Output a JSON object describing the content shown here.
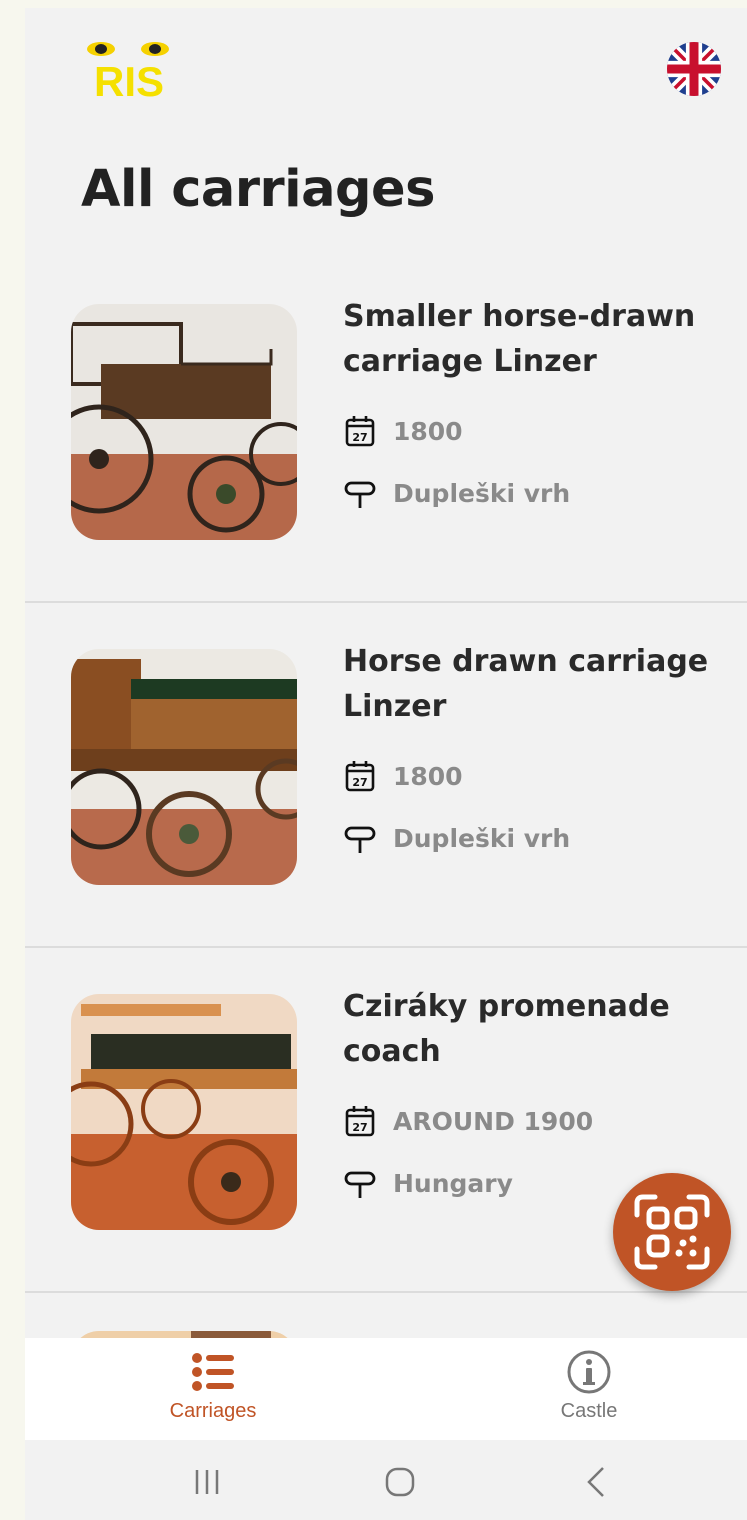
{
  "app": {
    "logo_text": "RIS",
    "language": "English (UK)",
    "title": "All carriages"
  },
  "carriages": [
    {
      "title": "Smaller horse-drawn carriage Linzer",
      "date": "1800",
      "location": "Dupleški vrh"
    },
    {
      "title": "Horse drawn carriage Linzer",
      "date": "1800",
      "location": "Dupleški vrh"
    },
    {
      "title": "Cziráky promenade coach",
      "date": "AROUND 1900",
      "location": "Hungary"
    }
  ],
  "fab": {
    "icon": "qr-scan-icon"
  },
  "bottom_nav": {
    "carriages": "Carriages",
    "castle": "Castle"
  },
  "colors": {
    "accent": "#c05426",
    "background": "#f2f2f2",
    "title": "#2a2a2a",
    "meta": "#8a8a8a"
  }
}
